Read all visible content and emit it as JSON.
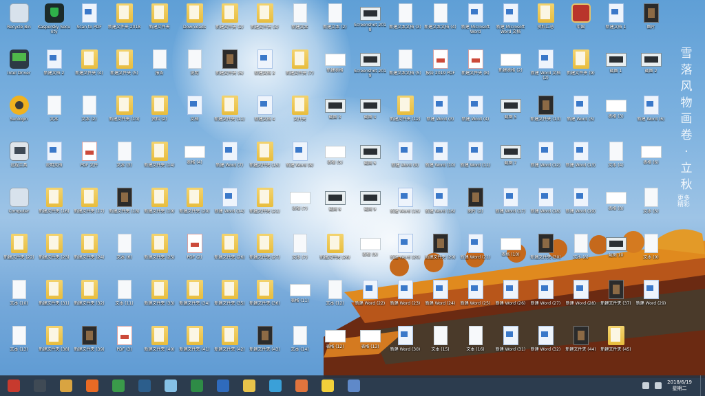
{
  "wallpaper": {
    "vertical_text": [
      "雪",
      "落",
      "风",
      "物",
      "画",
      "卷",
      "·",
      "立",
      "秋"
    ],
    "vertical_subtext": "更多精彩"
  },
  "desktop": {
    "icons": [
      {
        "type": "recycle",
        "label": "Recycle Bin"
      },
      {
        "type": "shield",
        "label": "Kaspersky Security"
      },
      {
        "type": "word",
        "label": "Scan to PDF"
      },
      {
        "type": "folder",
        "label": "新建文件夹 2018"
      },
      {
        "type": "folder",
        "label": "新建文件夹"
      },
      {
        "type": "folder",
        "label": "Downloads"
      },
      {
        "type": "folder",
        "label": "新建文件夹 (2)"
      },
      {
        "type": "folder",
        "label": "新建文件夹 (3)"
      },
      {
        "type": "doc",
        "label": "新建文本"
      },
      {
        "type": "doc",
        "label": "新建文本 (2)"
      },
      {
        "type": "shot",
        "label": "Screenshot 2018"
      },
      {
        "type": "doc",
        "label": "新建文本文档 (3)"
      },
      {
        "type": "doc",
        "label": "新建文本文档 (4)"
      },
      {
        "type": "word",
        "label": "新建 Microsoft Word"
      },
      {
        "type": "word",
        "label": "新建 Microsoft Word 文档"
      },
      {
        "type": "folder",
        "label": "资料汇总"
      },
      {
        "type": "app-red",
        "label": "中国"
      },
      {
        "type": "word",
        "label": "新建文档 1"
      },
      {
        "type": "dark",
        "label": "图片"
      },
      {
        "type": "monitor",
        "label": "Intel Driver"
      },
      {
        "type": "word",
        "label": "新建文档 2"
      },
      {
        "type": "folder",
        "label": "新建文件夹 (4)"
      },
      {
        "type": "folder",
        "label": "新建文件夹 (5)"
      },
      {
        "type": "doc",
        "label": "报告"
      },
      {
        "type": "doc",
        "label": "说明"
      },
      {
        "type": "dark",
        "label": "新建文件夹 (6)"
      },
      {
        "type": "word",
        "label": "新建文档 3"
      },
      {
        "type": "folder",
        "label": "新建文件夹 (7)"
      },
      {
        "type": "sheet",
        "label": "新建表格"
      },
      {
        "type": "shot",
        "label": "Screenshot 2019"
      },
      {
        "type": "doc",
        "label": "新建文本文档 (5)"
      },
      {
        "type": "pdf",
        "label": "报告 2019 PDF"
      },
      {
        "type": "pdf",
        "label": "新建文件夹 (8)"
      },
      {
        "type": "sheet",
        "label": "新建表格 (2)"
      },
      {
        "type": "word",
        "label": "新建 Word 文档 (2)"
      },
      {
        "type": "folder",
        "label": "新建文件夹 (9)"
      },
      {
        "type": "shot",
        "label": "截图 1"
      },
      {
        "type": "shot",
        "label": "截图 2"
      },
      {
        "type": "sun",
        "label": "Sunlogin"
      },
      {
        "type": "doc",
        "label": "文本"
      },
      {
        "type": "doc",
        "label": "文本 (2)"
      },
      {
        "type": "folder",
        "label": "新建文件夹 (10)"
      },
      {
        "type": "folder",
        "label": "资料 (2)"
      },
      {
        "type": "word",
        "label": "文档"
      },
      {
        "type": "folder",
        "label": "新建文件夹 (11)"
      },
      {
        "type": "word",
        "label": "新建文档 4"
      },
      {
        "type": "folder",
        "label": "文件夹"
      },
      {
        "type": "shot",
        "label": "截图 3"
      },
      {
        "type": "shot",
        "label": "截图 4"
      },
      {
        "type": "folder",
        "label": "新建文件夹 (12)"
      },
      {
        "type": "word",
        "label": "新建 Word (3)"
      },
      {
        "type": "word",
        "label": "新建 Word (4)"
      },
      {
        "type": "shot",
        "label": "截图 5"
      },
      {
        "type": "dark",
        "label": "新建文件夹 (13)"
      },
      {
        "type": "word",
        "label": "新建 Word (5)"
      },
      {
        "type": "sheet",
        "label": "表格 (3)"
      },
      {
        "type": "word",
        "label": "新建 Word (6)"
      },
      {
        "type": "tool",
        "label": "远程工具"
      },
      {
        "type": "word",
        "label": "说明文档"
      },
      {
        "type": "pdf",
        "label": "PDF 文件"
      },
      {
        "type": "doc",
        "label": "文本 (3)"
      },
      {
        "type": "folder",
        "label": "新建文件夹 (14)"
      },
      {
        "type": "sheet",
        "label": "表格 (4)"
      },
      {
        "type": "word",
        "label": "新建 Word (7)"
      },
      {
        "type": "folder",
        "label": "新建文件夹 (15)"
      },
      {
        "type": "word",
        "label": "新建 Word (8)"
      },
      {
        "type": "sheet",
        "label": "表格 (5)"
      },
      {
        "type": "shot",
        "label": "截图 6"
      },
      {
        "type": "word",
        "label": "新建 Word (9)"
      },
      {
        "type": "word",
        "label": "新建 Word (10)"
      },
      {
        "type": "word",
        "label": "新建 Word (11)"
      },
      {
        "type": "shot",
        "label": "截图 7"
      },
      {
        "type": "word",
        "label": "新建 Word (12)"
      },
      {
        "type": "word",
        "label": "新建 Word (13)"
      },
      {
        "type": "doc",
        "label": "文本 (4)"
      },
      {
        "type": "sheet",
        "label": "表格 (6)"
      },
      {
        "type": "recycle",
        "label": "Computer"
      },
      {
        "type": "folder",
        "label": "新建文件夹 (16)"
      },
      {
        "type": "folder",
        "label": "新建文件夹 (17)"
      },
      {
        "type": "dark",
        "label": "新建文件夹 (18)"
      },
      {
        "type": "folder",
        "label": "新建文件夹 (19)"
      },
      {
        "type": "folder",
        "label": "新建文件夹 (20)"
      },
      {
        "type": "word",
        "label": "新建 Word (14)"
      },
      {
        "type": "folder",
        "label": "新建文件夹 (21)"
      },
      {
        "type": "sheet",
        "label": "表格 (7)"
      },
      {
        "type": "shot",
        "label": "截图 8"
      },
      {
        "type": "shot",
        "label": "截图 9"
      },
      {
        "type": "word",
        "label": "新建 Word (15)"
      },
      {
        "type": "word",
        "label": "新建 Word (16)"
      },
      {
        "type": "dark",
        "label": "图片 (2)"
      },
      {
        "type": "word",
        "label": "新建 Word (17)"
      },
      {
        "type": "word",
        "label": "新建 Word (18)"
      },
      {
        "type": "word",
        "label": "新建 Word (19)"
      },
      {
        "type": "sheet",
        "label": "表格 (8)"
      },
      {
        "type": "doc",
        "label": "文本 (5)"
      },
      {
        "type": "folder",
        "label": "新建文件夹 (22)"
      },
      {
        "type": "folder",
        "label": "新建文件夹 (23)"
      },
      {
        "type": "folder",
        "label": "新建文件夹 (24)"
      },
      {
        "type": "doc",
        "label": "文本 (6)"
      },
      {
        "type": "folder",
        "label": "新建文件夹 (25)"
      },
      {
        "type": "pdf",
        "label": "PDF (2)"
      },
      {
        "type": "folder",
        "label": "新建文件夹 (26)"
      },
      {
        "type": "folder",
        "label": "新建文件夹 (27)"
      },
      {
        "type": "doc",
        "label": "文本 (7)"
      },
      {
        "type": "folder",
        "label": "新建文件夹 (28)"
      },
      {
        "type": "sheet",
        "label": "表格 (9)"
      },
      {
        "type": "word",
        "label": "新建 Word (20)"
      },
      {
        "type": "dark",
        "label": "新建文件夹 (29)"
      },
      {
        "type": "word",
        "label": "新建 Word (21)"
      },
      {
        "type": "sheet",
        "label": "表格 (10)"
      },
      {
        "type": "dark",
        "label": "新建文件夹 (30)"
      },
      {
        "type": "doc",
        "label": "文本 (8)"
      },
      {
        "type": "shot",
        "label": "截图 10"
      },
      {
        "type": "doc",
        "label": "文本 (9)"
      },
      {
        "type": "doc",
        "label": "文本 (10)"
      },
      {
        "type": "folder",
        "label": "新建文件夹 (31)"
      },
      {
        "type": "folder",
        "label": "新建文件夹 (32)"
      },
      {
        "type": "doc",
        "label": "文本 (11)"
      },
      {
        "type": "folder",
        "label": "新建文件夹 (33)"
      },
      {
        "type": "folder",
        "label": "新建文件夹 (34)"
      },
      {
        "type": "folder",
        "label": "新建文件夹 (35)"
      },
      {
        "type": "folder",
        "label": "新建文件夹 (36)"
      },
      {
        "type": "sheet",
        "label": "表格 (11)"
      },
      {
        "type": "doc",
        "label": "文本 (12)"
      },
      {
        "type": "word",
        "label": "新建 Word (22)"
      },
      {
        "type": "word",
        "label": "新建 Word (23)"
      },
      {
        "type": "word",
        "label": "新建 Word (24)"
      },
      {
        "type": "word",
        "label": "新建 Word (25)"
      },
      {
        "type": "word",
        "label": "新建 Word (26)"
      },
      {
        "type": "word",
        "label": "新建 Word (27)"
      },
      {
        "type": "word",
        "label": "新建 Word (28)"
      },
      {
        "type": "dark",
        "label": "新建文件夹 (37)"
      },
      {
        "type": "word",
        "label": "新建 Word (29)"
      },
      {
        "type": "doc",
        "label": "文本 (13)"
      },
      {
        "type": "folder",
        "label": "新建文件夹 (38)"
      },
      {
        "type": "dark",
        "label": "新建文件夹 (39)"
      },
      {
        "type": "pdf",
        "label": "PDF (3)"
      },
      {
        "type": "folder",
        "label": "新建文件夹 (40)"
      },
      {
        "type": "folder",
        "label": "新建文件夹 (41)"
      },
      {
        "type": "folder",
        "label": "新建文件夹 (42)"
      },
      {
        "type": "dark",
        "label": "新建文件夹 (43)"
      },
      {
        "type": "doc",
        "label": "文本 (14)"
      },
      {
        "type": "sheet",
        "label": "表格 (12)"
      },
      {
        "type": "sheet",
        "label": "表格 (13)"
      },
      {
        "type": "word",
        "label": "新建 Word (30)"
      },
      {
        "type": "doc",
        "label": "文本 (15)"
      },
      {
        "type": "doc",
        "label": "文本 (16)"
      },
      {
        "type": "word",
        "label": "新建 Word (31)"
      },
      {
        "type": "word",
        "label": "新建 Word (32)"
      },
      {
        "type": "dark",
        "label": "新建文件夹 (44)"
      },
      {
        "type": "folder",
        "label": "新建文件夹 (45)"
      }
    ]
  },
  "taskbar": {
    "items": [
      {
        "name": "start-app-red",
        "color": "#c73a2e"
      },
      {
        "name": "app-dark",
        "color": "#3f4a55"
      },
      {
        "name": "app-folder",
        "color": "#d9a441"
      },
      {
        "name": "app-firefox",
        "color": "#e96a24"
      },
      {
        "name": "app-chrome",
        "color": "#3a9a4a"
      },
      {
        "name": "app-terminal",
        "color": "#2c5e8c"
      },
      {
        "name": "app-paint",
        "color": "#86c1e6"
      },
      {
        "name": "app-excel",
        "color": "#2e8b46"
      },
      {
        "name": "app-word",
        "color": "#2f6bbd"
      },
      {
        "name": "app-files",
        "color": "#e8c34a"
      },
      {
        "name": "app-ie",
        "color": "#3aa0d8"
      },
      {
        "name": "app-photos",
        "color": "#e0743d"
      },
      {
        "name": "app-notes",
        "color": "#f2d03a"
      },
      {
        "name": "app-settings",
        "color": "#5f89c9"
      }
    ],
    "clock_time": "2018/6/19",
    "clock_date": "星期二"
  }
}
